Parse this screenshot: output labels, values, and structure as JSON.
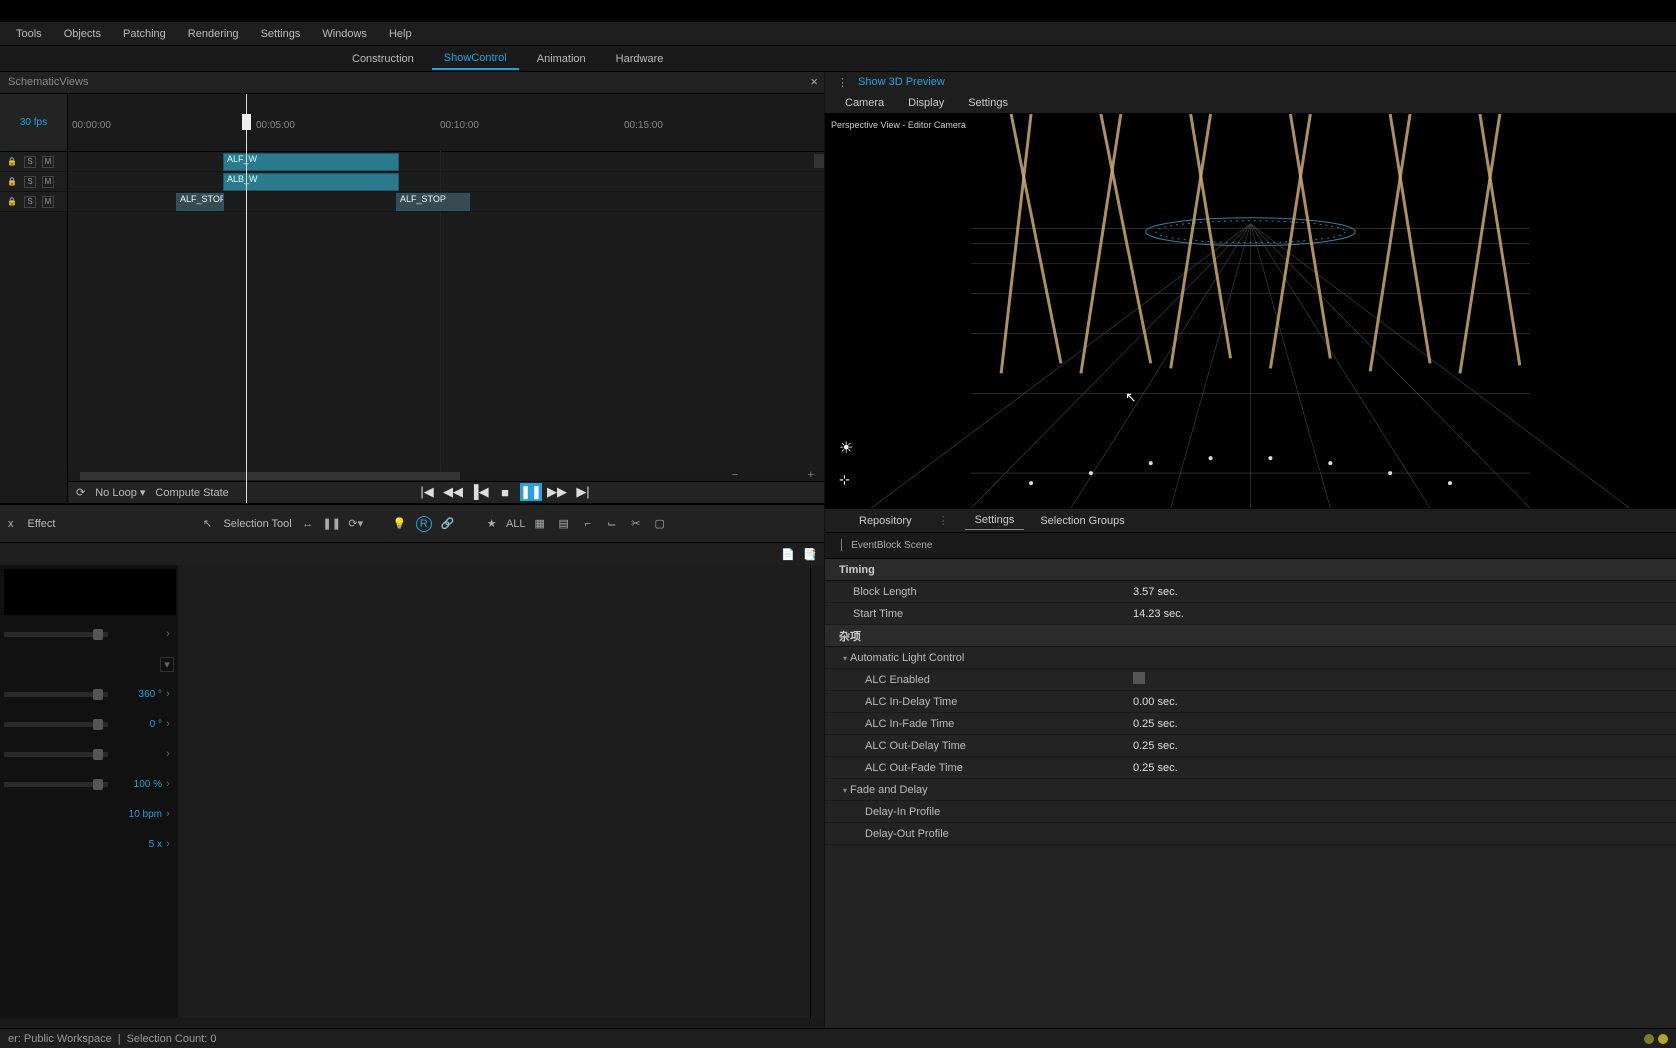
{
  "menu": {
    "tools": "Tools",
    "objects": "Objects",
    "patching": "Patching",
    "rendering": "Rendering",
    "settings": "Settings",
    "windows": "Windows",
    "help": "Help"
  },
  "subbar": {
    "construction": "Construction",
    "showcontrol": "ShowControl",
    "animation": "Animation",
    "hardware": "Hardware"
  },
  "schematic": {
    "title": "SchematicViews"
  },
  "timeline": {
    "fps": "30 fps",
    "t0": "00:00:00",
    "t1": "00:05:00",
    "t2": "00:10:00",
    "t3": "00:15:00",
    "clip1": "ALF_W",
    "clip2": "ALB_W",
    "clip3": "ALF_STOP",
    "clip4": "ALF_STOP",
    "noloop": "No Loop",
    "compute": "Compute State",
    "solo": "S",
    "mute": "M"
  },
  "fx": {
    "effect": "Effect",
    "seltool": "Selection Tool",
    "all": "ALL",
    "v1": "360 °",
    "v2": "0 °",
    "v3": "100 %",
    "v4": "10 bpm",
    "v5": "5 x"
  },
  "preview": {
    "show3d": "Show 3D Preview",
    "camera": "Camera",
    "display": "Display",
    "settings": "Settings",
    "vplabel": "Perspective View - Editor Camera"
  },
  "props": {
    "repository": "Repository",
    "settings": "Settings",
    "selgroups": "Selection Groups",
    "crumb": "EventBlock Scene",
    "timing": "Timing",
    "blocklen_l": "Block Length",
    "blocklen_v": "3.57 sec.",
    "start_l": "Start Time",
    "start_v": "14.23 sec.",
    "misc": "杂项",
    "alc": "Automatic Light Control",
    "alcenabled": "ALC Enabled",
    "alc_in_delay_l": "ALC In-Delay Time",
    "alc_in_delay_v": "0.00 sec.",
    "alc_in_fade_l": "ALC In-Fade Time",
    "alc_in_fade_v": "0.25 sec.",
    "alc_out_delay_l": "ALC Out-Delay Time",
    "alc_out_delay_v": "0.25 sec.",
    "alc_out_fade_l": "ALC Out-Fade Time",
    "alc_out_fade_v": "0.25 sec.",
    "fadedelay": "Fade and Delay",
    "delayin": "Delay-In Profile",
    "delayout": "Delay-Out Profile"
  },
  "status": {
    "left_workspace": "er: Public Workspace",
    "left_sel": "Selection Count: 0"
  }
}
